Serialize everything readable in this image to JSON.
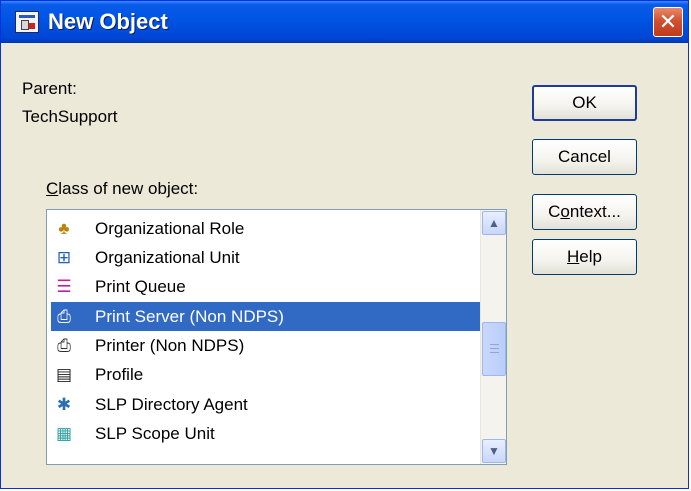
{
  "window": {
    "title": "New Object",
    "close_glyph": "✕"
  },
  "parent": {
    "label": "Parent:",
    "value": "TechSupport"
  },
  "class_list": {
    "label_access_key": "C",
    "label_rest": "lass of new object:",
    "items": [
      {
        "label": "Organizational Role",
        "icon": "organizational-role-icon",
        "glyph": "♣",
        "color": "#b8860b"
      },
      {
        "label": "Organizational Unit",
        "icon": "organizational-unit-icon",
        "glyph": "⊞",
        "color": "#2060c0"
      },
      {
        "label": "Print Queue",
        "icon": "print-queue-icon",
        "glyph": "☰",
        "color": "#c020a0"
      },
      {
        "label": "Print Server (Non NDPS)",
        "icon": "print-server-icon",
        "glyph": "⎙",
        "color": "#ffffff",
        "selected": true
      },
      {
        "label": "Printer (Non NDPS)",
        "icon": "printer-icon",
        "glyph": "⎙",
        "color": "#303030"
      },
      {
        "label": "Profile",
        "icon": "profile-icon",
        "glyph": "▤",
        "color": "#202020"
      },
      {
        "label": "SLP Directory Agent",
        "icon": "slp-directory-agent-icon",
        "glyph": "✱",
        "color": "#2a70b0"
      },
      {
        "label": "SLP Scope Unit",
        "icon": "slp-scope-unit-icon",
        "glyph": "▦",
        "color": "#2aa0a0"
      }
    ],
    "scroll_up_glyph": "▲",
    "scroll_down_glyph": "▼"
  },
  "buttons": {
    "ok": "OK",
    "cancel": "Cancel",
    "context_prefix": "C",
    "context_access_key": "o",
    "context_rest": "ntext...",
    "help_access_key": "H",
    "help_rest": "elp"
  },
  "colors": {
    "title_bar": "#0055e5",
    "selection": "#316ac5",
    "dialog_face": "#ece9d8"
  }
}
